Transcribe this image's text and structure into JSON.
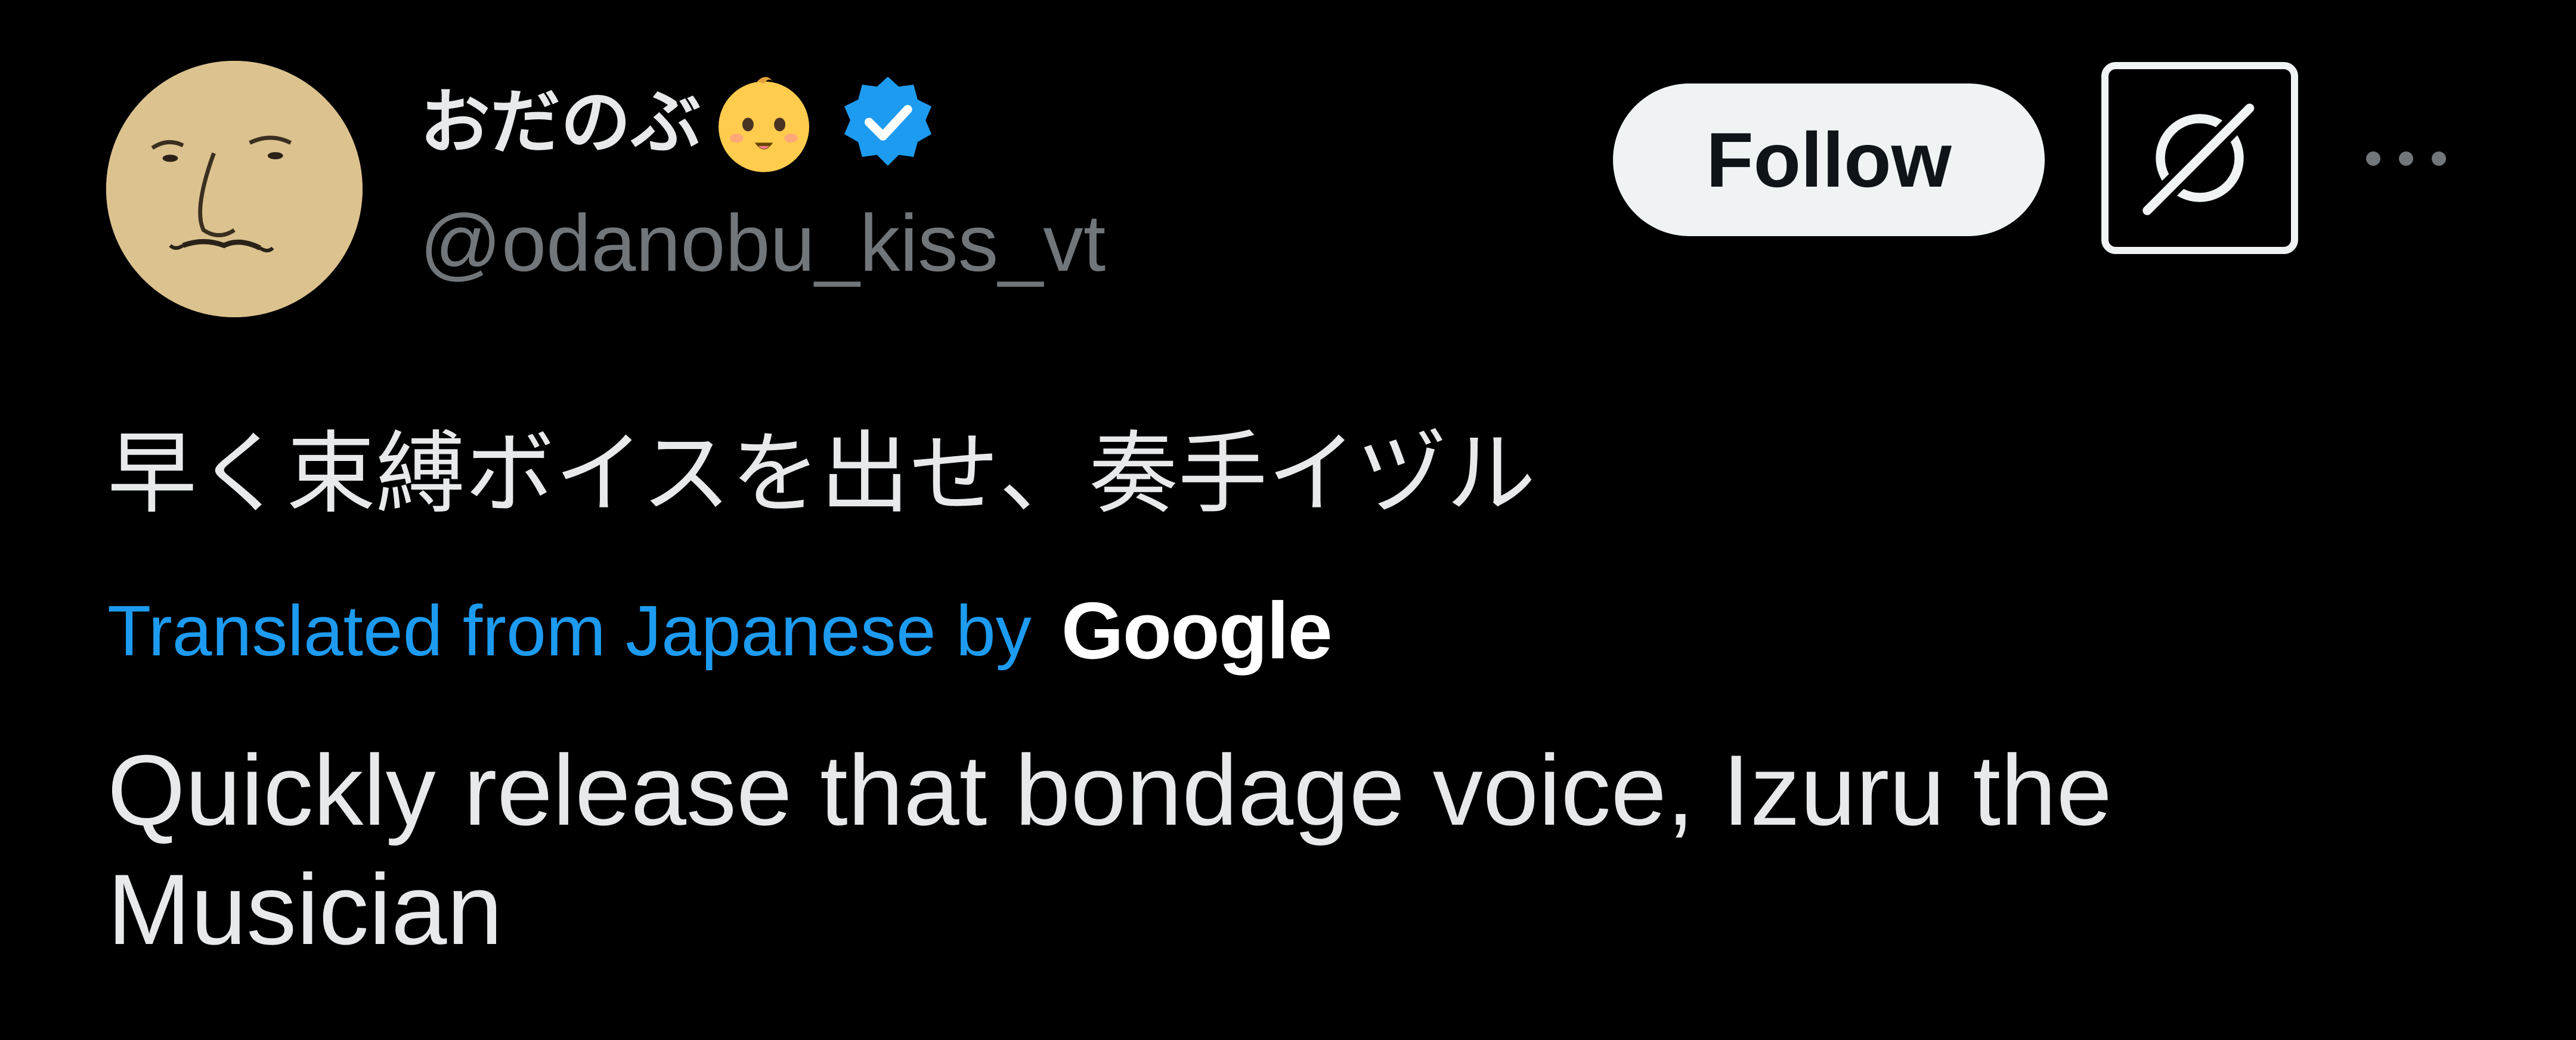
{
  "author": {
    "display_name": "おだのぶ",
    "display_name_emoji": "baby-face-emoji",
    "verified_badge": "verified-icon",
    "verified_color": "#1d9bf0",
    "handle": "@odanobu_kiss_vt"
  },
  "actions": {
    "follow_label": "Follow",
    "grok_icon": "grok-icon",
    "more_icon": "more-options-icon"
  },
  "tweet": {
    "text": "早く束縛ボイスを出せ、奏手イヅル",
    "translated_label": "Translated from Japanese by",
    "translator_logo": "Google",
    "translation": "Quickly release that bondage voice, Izuru the Musician"
  },
  "colors": {
    "background": "#000000",
    "text": "#e7e9ea",
    "secondary_text": "#71767b",
    "link": "#1d9bf0",
    "button_bg": "#eff3f4"
  }
}
